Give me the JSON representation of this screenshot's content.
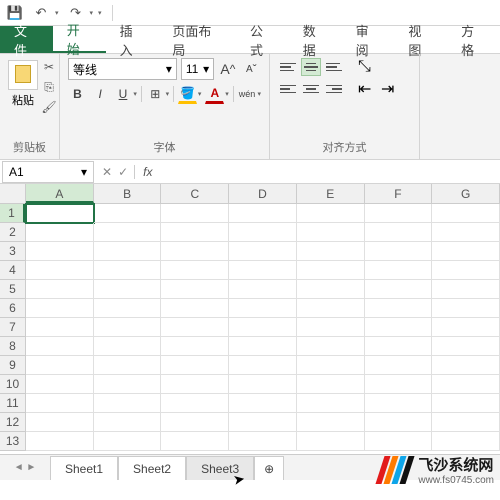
{
  "qat": {
    "save": "💾",
    "undo": "↶",
    "redo": "↷"
  },
  "tabs": {
    "file": "文件",
    "home": "开始",
    "insert": "插入",
    "layout": "页面布局",
    "formulas": "公式",
    "data": "数据",
    "review": "审阅",
    "view": "视图",
    "square": "方格"
  },
  "ribbon": {
    "clipboard": {
      "paste": "粘贴",
      "label": "剪贴板"
    },
    "font": {
      "name": "等线",
      "size": "11",
      "bold": "B",
      "italic": "I",
      "underline": "U",
      "increase": "A",
      "decrease": "A",
      "wen": "wén",
      "label": "字体"
    },
    "align": {
      "label": "对齐方式"
    }
  },
  "namebox": "A1",
  "fx": "fx",
  "fbar_btns": {
    "cancel": "✕",
    "confirm": "✓"
  },
  "columns": [
    "A",
    "B",
    "C",
    "D",
    "E",
    "F",
    "G"
  ],
  "rows": [
    "1",
    "2",
    "3",
    "4",
    "5",
    "6",
    "7",
    "8",
    "9",
    "10",
    "11",
    "12",
    "13"
  ],
  "sheets": {
    "s1": "Sheet1",
    "s2": "Sheet2",
    "s3": "Sheet3",
    "new": "⊕"
  },
  "watermark": {
    "brand": "飞沙系统网",
    "url": "www.fs0745.com"
  }
}
